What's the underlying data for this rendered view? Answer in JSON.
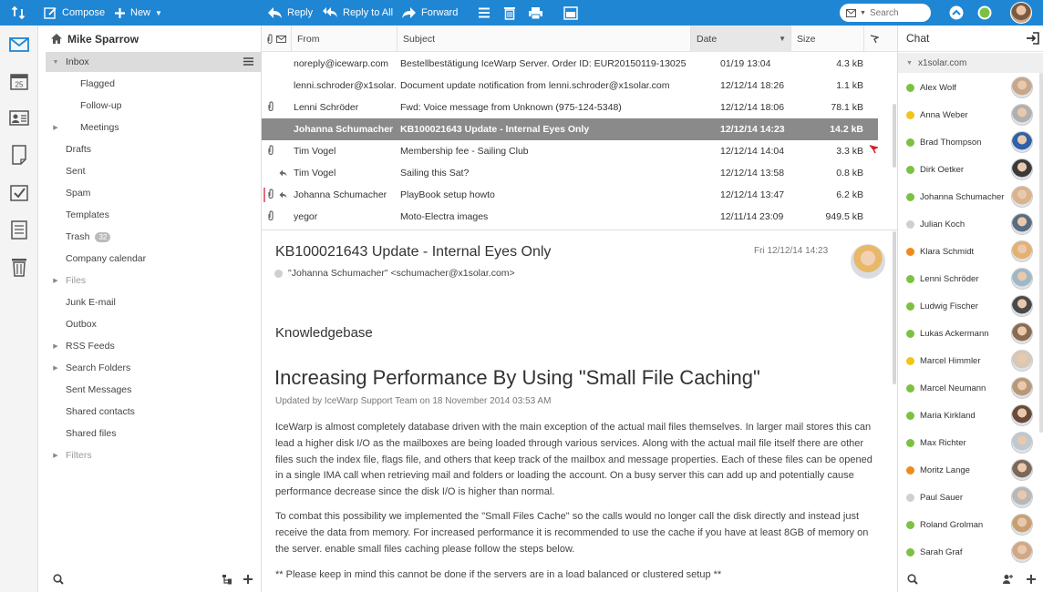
{
  "toolbar": {
    "compose": "Compose",
    "new": "New",
    "reply": "Reply",
    "reply_all": "Reply to All",
    "forward": "Forward",
    "search_placeholder": "Search",
    "bg_color": "#1f86d4"
  },
  "account": {
    "name": "Mike Sparrow"
  },
  "folders": [
    {
      "label": "Inbox",
      "arrow": "▼",
      "selected": true
    },
    {
      "label": "Flagged",
      "sub": true
    },
    {
      "label": "Follow-up",
      "sub": true
    },
    {
      "label": "Meetings",
      "sub": true,
      "arrow": "▶"
    },
    {
      "label": "Drafts"
    },
    {
      "label": "Sent"
    },
    {
      "label": "Spam"
    },
    {
      "label": "Templates"
    },
    {
      "label": "Trash",
      "badge": "32"
    },
    {
      "label": "Company calendar"
    },
    {
      "label": "Files",
      "arrow": "▶",
      "muted": true
    },
    {
      "label": "Junk E-mail"
    },
    {
      "label": "Outbox"
    },
    {
      "label": "RSS Feeds",
      "arrow": "▶"
    },
    {
      "label": "Search Folders",
      "arrow": "▶"
    },
    {
      "label": "Sent Messages"
    },
    {
      "label": "Shared contacts"
    },
    {
      "label": "Shared files"
    },
    {
      "label": "Filters",
      "arrow": "▶",
      "muted": true
    }
  ],
  "list": {
    "columns": {
      "from": "From",
      "subject": "Subject",
      "date": "Date",
      "size": "Size"
    },
    "rows": [
      {
        "from": "noreply@icewarp.com",
        "subject": "Bestellbestätigung IceWarp Server. Order ID: EUR20150119-13025",
        "date": "01/19 13:04",
        "size": "4.3 kB",
        "attach": false,
        "replied": false,
        "flag": false
      },
      {
        "from": "lenni.schroder@x1solar.c",
        "subject": "Document update notification from lenni.schroder@x1solar.com",
        "date": "12/12/14 18:26",
        "size": "1.1 kB",
        "attach": false,
        "replied": false,
        "flag": false
      },
      {
        "from": "Lenni Schröder",
        "subject": "Fwd: Voice message from Unknown (975-124-5348)",
        "date": "12/12/14 18:06",
        "size": "78.1 kB",
        "attach": true,
        "replied": false,
        "flag": false
      },
      {
        "from": "Johanna Schumacher",
        "subject": "KB100021643 Update - Internal Eyes Only",
        "date": "12/12/14 14:23",
        "size": "14.2 kB",
        "attach": false,
        "replied": false,
        "flag": false,
        "selected": true
      },
      {
        "from": "Tim Vogel",
        "subject": "Membership fee - Sailing Club",
        "date": "12/12/14 14:04",
        "size": "3.3 kB",
        "attach": true,
        "replied": false,
        "flag": true
      },
      {
        "from": "Tim Vogel",
        "subject": "Sailing this Sat?",
        "date": "12/12/14 13:58",
        "size": "0.8 kB",
        "attach": false,
        "replied": true,
        "flag": false
      },
      {
        "from": "Johanna Schumacher",
        "subject": "PlayBook setup howto",
        "date": "12/12/14 13:47",
        "size": "6.2 kB",
        "attach": true,
        "replied": true,
        "flag": false
      },
      {
        "from": "yegor",
        "subject": "Moto-Electra images",
        "date": "12/11/14 23:09",
        "size": "949.5 kB",
        "attach": true,
        "replied": false,
        "flag": false
      }
    ]
  },
  "preview": {
    "subject": "KB100021643 Update - Internal Eyes Only",
    "date": "Fri 12/12/14 14:23",
    "from": "\"Johanna Schumacher\" <schumacher@x1solar.com>",
    "kb_title": "Knowledgebase",
    "heading": "Increasing Performance By Using \"Small File Caching\"",
    "updated": "Updated by IceWarp Support Team on 18 November 2014 03:53 AM",
    "p1": "IceWarp is almost completely database driven with the main exception of the actual mail files themselves.  In larger mail stores this can lead a higher disk I/O as the mailboxes are being loaded through various services.  Along with the actual mail file itself there are other files such the index file, flags file, and others that keep track of the mailbox and message properties.  Each of these files can be opened in a single IMA call when retrieving mail and folders or loading the account.  On a busy server this can add up and potentially cause performance decrease since the disk I/O is higher than normal.",
    "p2": "To combat this possibility we implemented the \"Small Files Cache\" so the calls would no longer call the disk directly and instead just receive the data from memory.  For increased performance it is recommended to use the cache if you have at least 8GB of memory on the server. enable small files caching please follow the steps below.",
    "p3": "** Please keep in mind this cannot be done if the servers are in a load balanced or clustered setup **"
  },
  "chat": {
    "title": "Chat",
    "domain": "x1solar.com",
    "contacts": [
      {
        "name": "Alex Wolf",
        "status": "#7cc142"
      },
      {
        "name": "Anna Weber",
        "status": "#f0c419"
      },
      {
        "name": "Brad Thompson",
        "status": "#7cc142"
      },
      {
        "name": "Dirk Oetker",
        "status": "#7cc142"
      },
      {
        "name": "Johanna Schumacher",
        "status": "#7cc142"
      },
      {
        "name": "Julian Koch",
        "status": "#cfcfcf"
      },
      {
        "name": "Klara Schmidt",
        "status": "#f08a1c"
      },
      {
        "name": "Lenni Schröder",
        "status": "#7cc142"
      },
      {
        "name": "Ludwig Fischer",
        "status": "#7cc142"
      },
      {
        "name": "Lukas Ackermann",
        "status": "#7cc142"
      },
      {
        "name": "Marcel Himmler",
        "status": "#f0c419"
      },
      {
        "name": "Marcel Neumann",
        "status": "#7cc142"
      },
      {
        "name": "Maria Kirkland",
        "status": "#7cc142"
      },
      {
        "name": "Max Richter",
        "status": "#7cc142"
      },
      {
        "name": "Moritz Lange",
        "status": "#f08a1c"
      },
      {
        "name": "Paul Sauer",
        "status": "#cfcfcf"
      },
      {
        "name": "Roland Grolman",
        "status": "#7cc142"
      },
      {
        "name": "Sarah Graf",
        "status": "#7cc142"
      }
    ]
  }
}
